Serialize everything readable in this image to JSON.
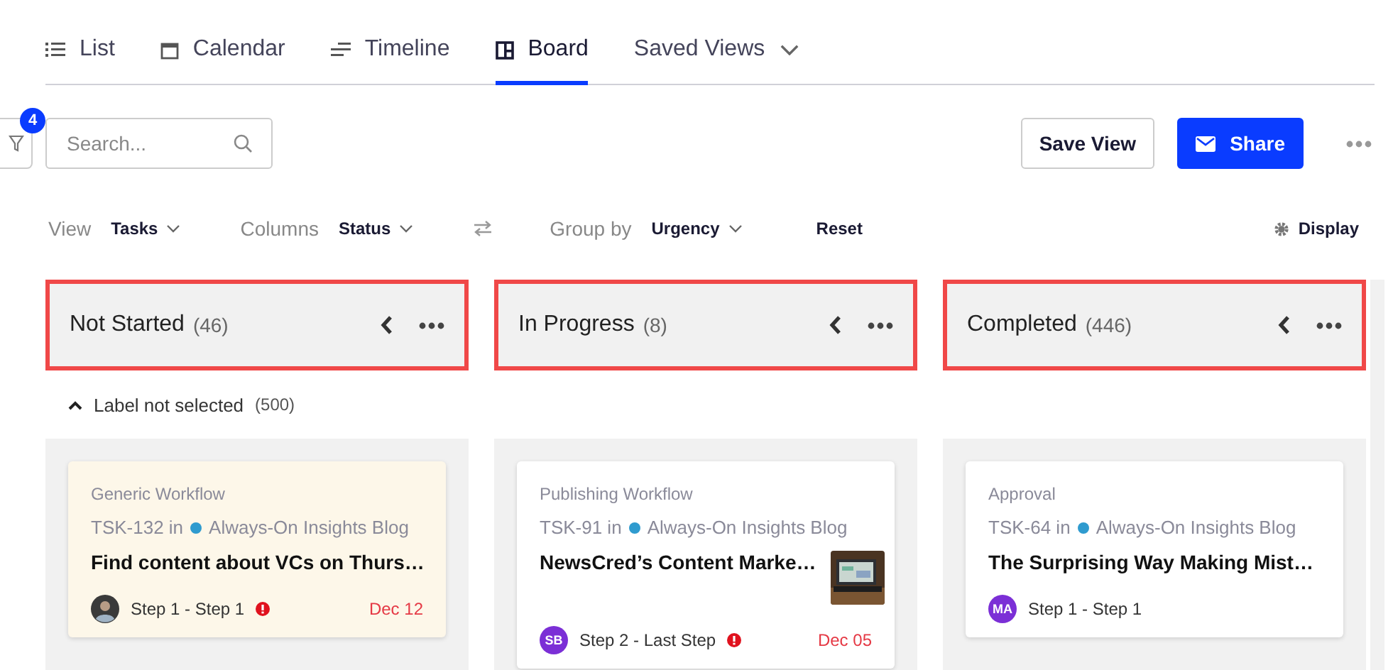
{
  "tabs": [
    {
      "label": "List",
      "selected": false
    },
    {
      "label": "Calendar",
      "selected": false
    },
    {
      "label": "Timeline",
      "selected": false
    },
    {
      "label": "Board",
      "selected": true
    },
    {
      "label": "Saved Views",
      "selected": false
    }
  ],
  "filter_badge": "4",
  "search": {
    "placeholder": "Search..."
  },
  "buttons": [
    {
      "label": "Save View",
      "kind": "secondary"
    },
    {
      "label": "Share",
      "kind": "primary"
    }
  ],
  "view_options": [
    {
      "label": "View",
      "value": "Tasks"
    },
    {
      "label": "Columns",
      "value": "Status"
    },
    {
      "label": "Group by",
      "value": "Urgency"
    }
  ],
  "reset": "Reset",
  "display": "Display",
  "columns": [
    {
      "title": "Not Started",
      "count": "(46)",
      "group": {
        "label": "Label not selected",
        "count": "(500)",
        "expanded": true
      },
      "cards": [
        {
          "workflow": "Generic Workflow",
          "task": "TSK-132 in",
          "project": "Always-On Insights Blog",
          "title": "Find content about VCs on Thurs…",
          "step": "Step 1 - Step 1",
          "alert": true,
          "due": "Dec 12",
          "highlighted": true,
          "thumbnail": false
        }
      ]
    },
    {
      "title": "In Progress",
      "count": "(8)",
      "cards": [
        {
          "workflow": "Publishing Workflow",
          "task": "TSK-91 in",
          "project": "Always-On Insights Blog",
          "title": "NewsCred’s Content Marke…",
          "avatar": {
            "kind": "initials",
            "initials": "SB"
          },
          "step": "Step 2 - Last Step",
          "alert": true,
          "due": "Dec 05",
          "highlighted": false,
          "thumbnail": true
        }
      ]
    },
    {
      "title": "Completed",
      "count": "(446)",
      "cards": [
        {
          "workflow": "Approval",
          "task": "TSK-64 in",
          "project": "Always-On Insights Blog",
          "title": "The Surprising Way Making Mist…",
          "avatar": {
            "kind": "initials",
            "initials": "MA"
          },
          "step": "Step 1 - Step 1",
          "alert": false,
          "highlighted": false,
          "thumbnail": false
        }
      ]
    }
  ]
}
